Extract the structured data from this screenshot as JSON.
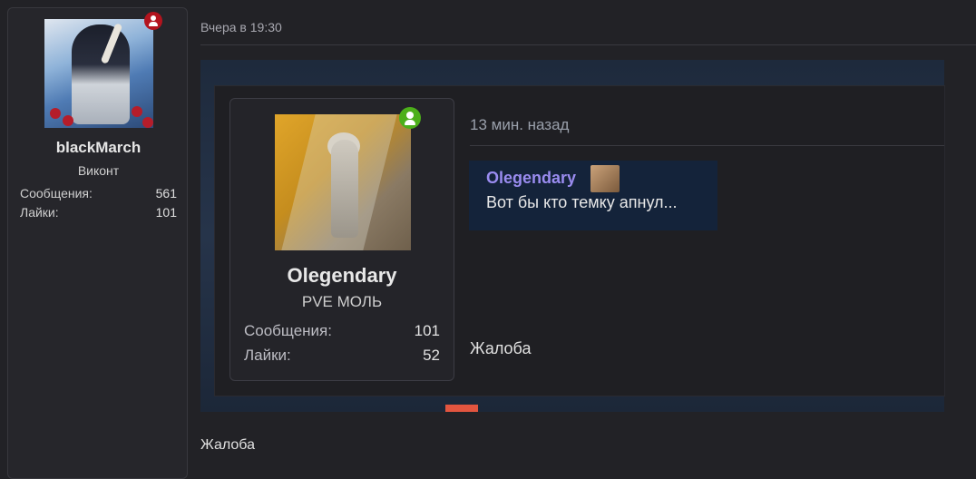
{
  "author": {
    "username": "blackMarch",
    "title": "Виконт",
    "stats": [
      {
        "label": "Сообщения:",
        "value": "561"
      },
      {
        "label": "Лайки:",
        "value": "101"
      }
    ],
    "status": "offline"
  },
  "post": {
    "date": "Вчера в 19:30",
    "report_label": "Жалоба"
  },
  "embed": {
    "time": "13 мин. назад",
    "report_label": "Жалоба",
    "user": {
      "username": "Olegendary",
      "title": "PVE МОЛЬ",
      "stats": [
        {
          "label": "Сообщения:",
          "value": "101"
        },
        {
          "label": "Лайки:",
          "value": "52"
        }
      ],
      "status": "online"
    },
    "quote": {
      "name": "Olegendary",
      "text": "Вот бы кто темку апнул..."
    }
  },
  "colors": {
    "background": "#222226",
    "panel": "#26262b",
    "quote_name": "#9a8cf0",
    "online": "#4caf1a",
    "offline": "#b3141e"
  }
}
